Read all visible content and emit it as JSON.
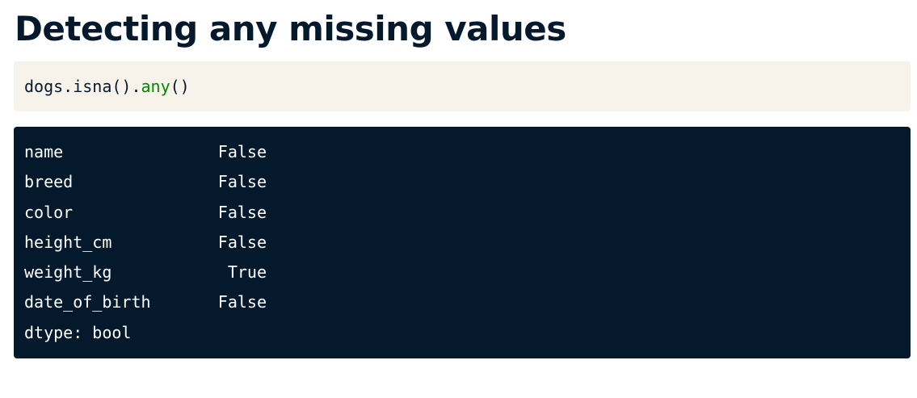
{
  "title": "Detecting any missing values",
  "code": {
    "object": "dogs.isna().",
    "method": "any",
    "call": "()"
  },
  "output": {
    "rows": [
      {
        "key": "name",
        "value": "False"
      },
      {
        "key": "breed",
        "value": "False"
      },
      {
        "key": "color",
        "value": "False"
      },
      {
        "key": "height_cm",
        "value": "False"
      },
      {
        "key": "weight_kg",
        "value": "True"
      },
      {
        "key": "date_of_birth",
        "value": "False"
      }
    ],
    "dtype": "dtype: bool"
  },
  "colors": {
    "title": "#05192d",
    "code_background": "#f7f3eb",
    "output_background": "#05192d",
    "method_highlight": "#008a00"
  }
}
